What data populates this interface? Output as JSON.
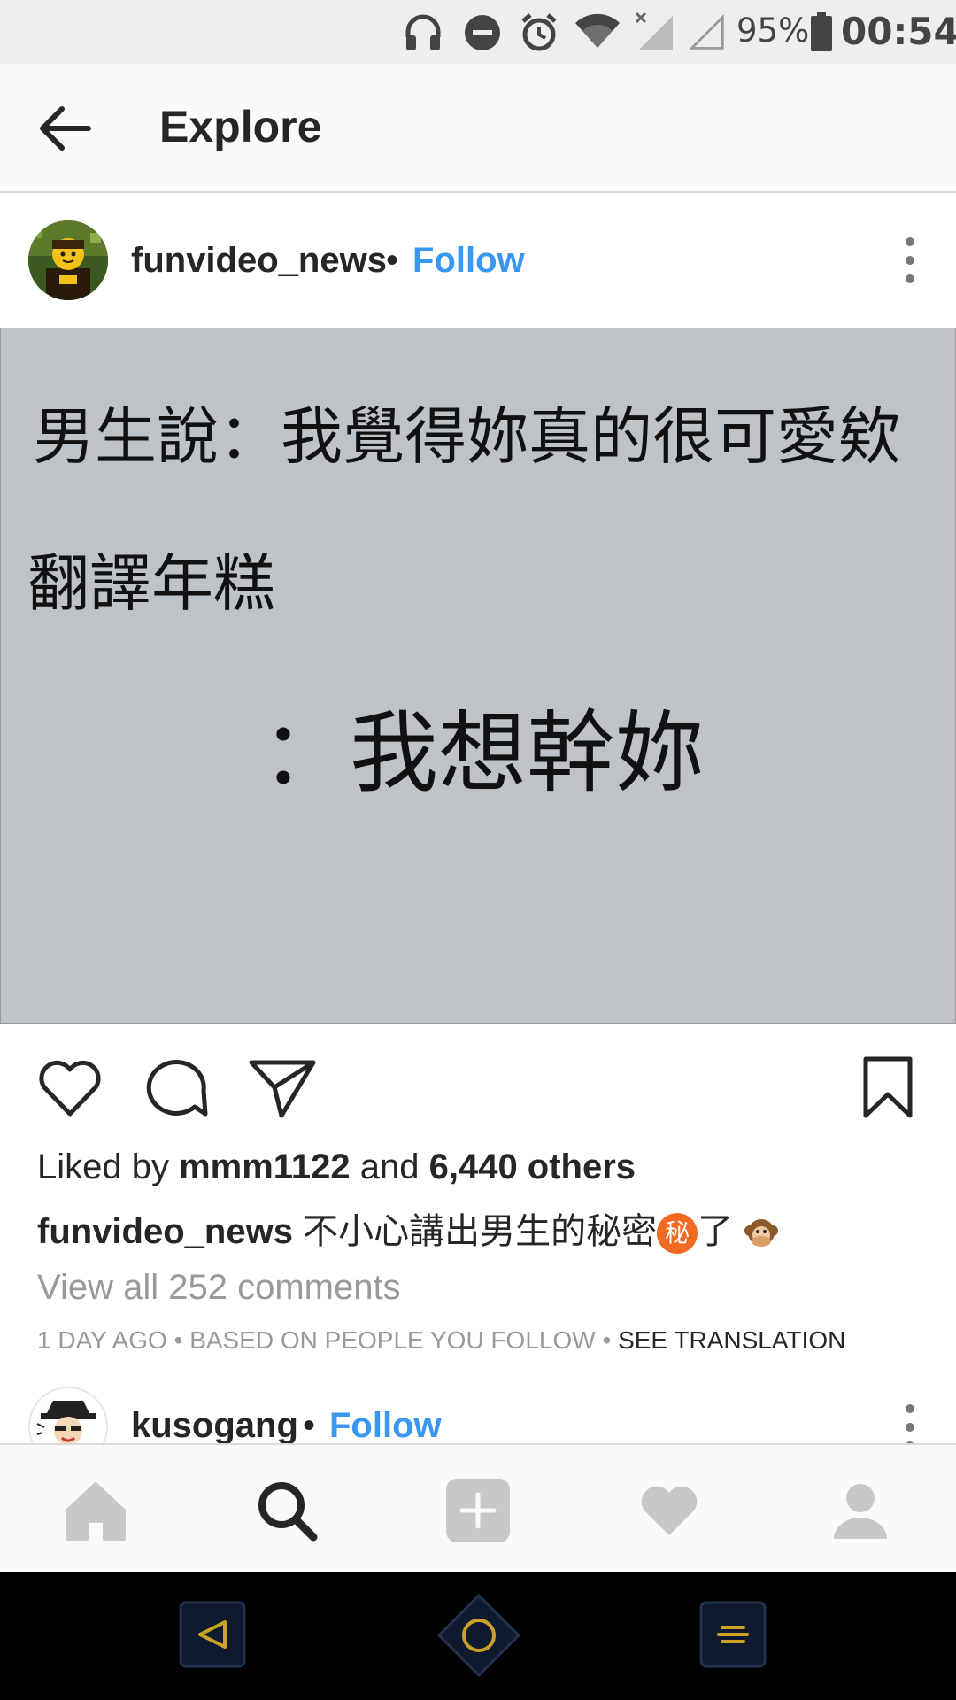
{
  "status_bar": {
    "battery": "95%",
    "time": "00:54"
  },
  "header": {
    "title": "Explore"
  },
  "post": {
    "username": "funvideo_news",
    "separator": "•",
    "follow_label": "Follow",
    "image_text": {
      "line1": "男生說：我覺得妳真的很可愛欸",
      "line2": "翻譯年糕",
      "line3": "：我想幹妳"
    },
    "likes": {
      "prefix": "Liked by",
      "liker": "mmm1122",
      "conjunction": "and",
      "others": "6,440 others"
    },
    "caption": {
      "username": "funvideo_news",
      "text": "不小心講出男生的秘密",
      "badge": "秘",
      "suffix": "了"
    },
    "view_comments": "View all 252 comments",
    "meta": {
      "time": "1 DAY AGO",
      "reason": "BASED ON PEOPLE YOU FOLLOW",
      "separator": "•",
      "translate": "SEE TRANSLATION"
    }
  },
  "next_post": {
    "username": "kusogang",
    "separator": "•",
    "follow_label": "Follow"
  },
  "icons": {
    "status": [
      "headphones-icon",
      "do-not-disturb-icon",
      "alarm-icon",
      "wifi-icon",
      "signal-icon",
      "battery-icon"
    ],
    "actions": [
      "heart-icon",
      "comment-icon",
      "share-icon",
      "bookmark-icon"
    ],
    "tabs": [
      "home-icon",
      "search-icon",
      "add-icon",
      "activity-heart-icon",
      "profile-icon"
    ],
    "nav": [
      "back-triangle-icon",
      "home-circle-icon",
      "recents-icon"
    ]
  },
  "colors": {
    "link_blue": "#3897f0",
    "image_bg": "#bec3c8",
    "muted_text": "#999999",
    "secret_badge": "#f26a21"
  }
}
